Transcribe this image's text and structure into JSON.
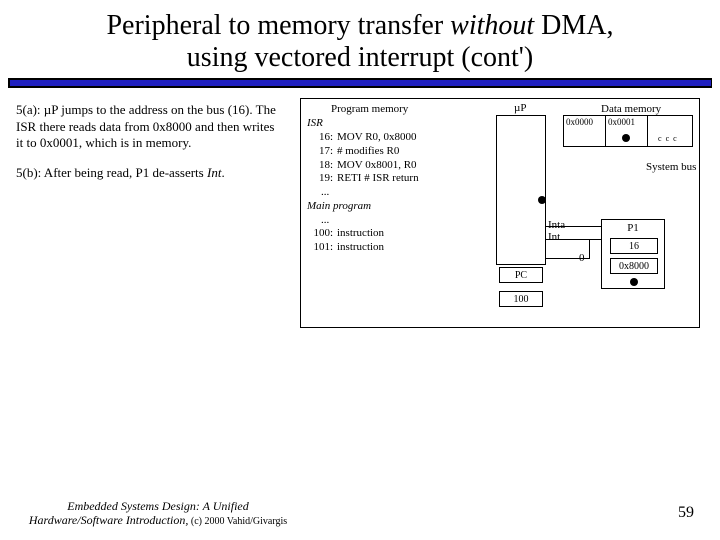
{
  "title": {
    "line1_pre": "Peripheral to memory transfer ",
    "line1_em": "without",
    "line1_post": " DMA,",
    "line2": "using vectored interrupt (cont')"
  },
  "explain": {
    "p1_pre": "5(a): µP jumps to the address on the bus (16). The ISR there reads data from 0x8000 and then writes it to 0x0001, which is in memory.",
    "p2_pre": "5(b): After being read, P1 de-asserts ",
    "p2_em": "Int",
    "p2_post": "."
  },
  "progmem": {
    "title": "Program memory",
    "isr": "ISR",
    "lines": [
      {
        "n": "16:",
        "t": "MOV R0, 0x8000"
      },
      {
        "n": "17:",
        "t": "# modifies R0"
      },
      {
        "n": "18:",
        "t": "MOV 0x8001, R0"
      },
      {
        "n": "19:",
        "t": "RETI  # ISR return"
      }
    ],
    "ellipsis": "...",
    "main": "Main program",
    "mlines": [
      {
        "n": "100:",
        "t": "instruction"
      },
      {
        "n": "101:",
        "t": "instruction"
      }
    ]
  },
  "uP": {
    "label": "µP",
    "inta": "Inta",
    "int": "Int",
    "pc": "PC",
    "pcval": "100",
    "zero": "0"
  },
  "datamem": {
    "title": "Data memory",
    "c0": "0x0000",
    "c1": "0x0001"
  },
  "sysbus": "System bus",
  "p1": {
    "title": "P1",
    "v1": "16",
    "v2": "0x8000"
  },
  "footer": {
    "line1": "Embedded Systems Design: A Unified",
    "line2_em": "Hardware/Software Introduction,",
    "line2_rest": " (c) 2000 Vahid/Givargis"
  },
  "page": "59"
}
